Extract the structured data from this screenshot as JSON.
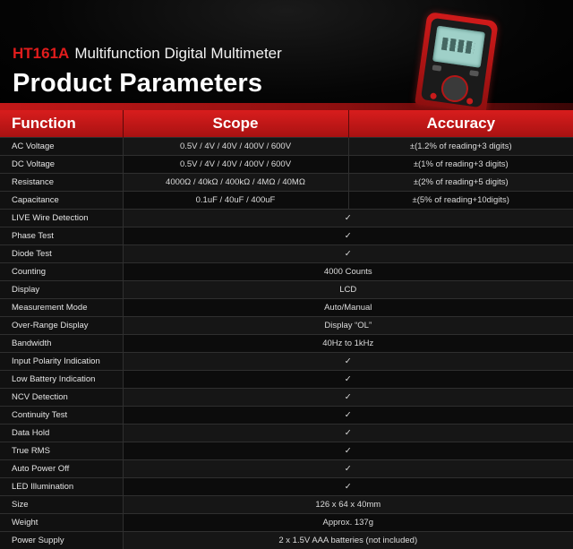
{
  "header": {
    "model": "HT161A",
    "product_title": "Multifunction Digital Multimeter",
    "heading": "Product Parameters"
  },
  "table": {
    "columns": [
      "Function",
      "Scope",
      "Accuracy"
    ],
    "check_symbol": "✓",
    "rows": [
      {
        "function": "AC Voltage",
        "scope": "0.5V / 4V / 40V / 400V / 600V",
        "accuracy": "±(1.2% of reading+3 digits)"
      },
      {
        "function": "DC Voltage",
        "scope": "0.5V / 4V / 40V / 400V / 600V",
        "accuracy": "±(1% of reading+3 digits)"
      },
      {
        "function": "Resistance",
        "scope": "4000Ω / 40kΩ / 400kΩ / 4MΩ / 40MΩ",
        "accuracy": "±(2% of reading+5 digits)"
      },
      {
        "function": "Capacitance",
        "scope": "0.1uF / 40uF / 400uF",
        "accuracy": "±(5% of reading+10digits)"
      },
      {
        "function": "LIVE Wire Detection",
        "value": "✓"
      },
      {
        "function": "Phase Test",
        "value": "✓"
      },
      {
        "function": "Diode Test",
        "value": "✓"
      },
      {
        "function": "Counting",
        "value": "4000 Counts"
      },
      {
        "function": "Display",
        "value": "LCD"
      },
      {
        "function": "Measurement Mode",
        "value": "Auto/Manual"
      },
      {
        "function": "Over-Range Display",
        "value": "Display “OL”"
      },
      {
        "function": "Bandwidth",
        "value": "40Hz to 1kHz"
      },
      {
        "function": "Input Polarity Indication",
        "value": "✓"
      },
      {
        "function": "Low Battery Indication",
        "value": "✓"
      },
      {
        "function": "NCV Detection",
        "value": "✓"
      },
      {
        "function": "Continuity Test",
        "value": "✓"
      },
      {
        "function": "Data Hold",
        "value": "✓"
      },
      {
        "function": "True RMS",
        "value": "✓"
      },
      {
        "function": "Auto Power Off",
        "value": "✓"
      },
      {
        "function": "LED Illumination",
        "value": "✓"
      },
      {
        "function": "Size",
        "value": "126 x 64 x 40mm"
      },
      {
        "function": "Weight",
        "value": "Approx. 137g"
      },
      {
        "function": "Power Supply",
        "value": "2 x 1.5V AAA batteries (not included)"
      }
    ]
  }
}
